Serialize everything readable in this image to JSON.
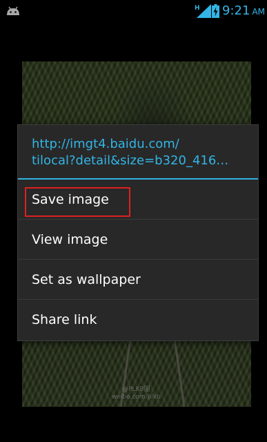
{
  "status_bar": {
    "time": "9:21",
    "ampm": "AM",
    "network_type": "H",
    "icons": [
      "android-icon",
      "signal-icon",
      "battery-charging-icon"
    ],
    "accent_color": "#33b5e5"
  },
  "background": {
    "watermark_line1": "@PLKB国",
    "watermark_line2": "weibo.com/plkb"
  },
  "dialog": {
    "title_line1": "http://imgt4.baidu.com/",
    "title_line2": "tilocal?detail&size=b320_416…",
    "items": [
      {
        "label": "Save image"
      },
      {
        "label": "View image"
      },
      {
        "label": "Set as wallpaper"
      },
      {
        "label": "Share link"
      }
    ],
    "highlight_color": "#e02020"
  }
}
